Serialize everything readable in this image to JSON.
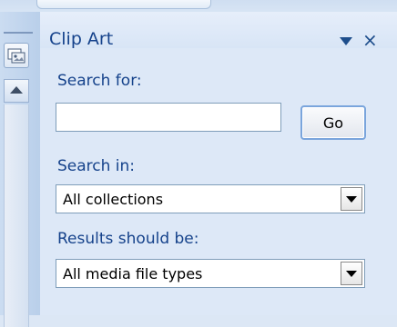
{
  "pane": {
    "title": "Clip Art",
    "menu_icon": "down-triangle",
    "close_label": "×"
  },
  "search": {
    "label": "Search for:",
    "value": "",
    "placeholder": "",
    "go_label": "Go"
  },
  "search_in": {
    "label": "Search in:",
    "selected": "All collections"
  },
  "results": {
    "label": "Results should be:",
    "selected": "All media file types"
  },
  "colors": {
    "label_text": "#15428b",
    "pane_background": "#dde8f7",
    "button_border": "#7aa5dc"
  }
}
